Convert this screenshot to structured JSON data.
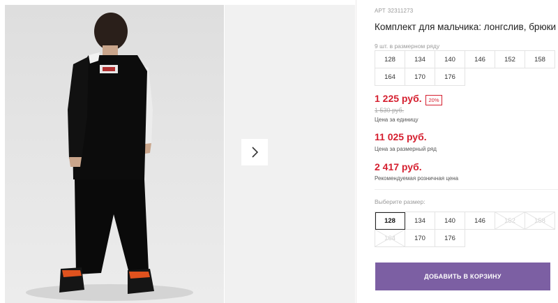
{
  "gallery": {
    "next_icon": "chevron-right-icon",
    "photo_subject": "boy-in-black-longsleeve-and-pants-back-view"
  },
  "product": {
    "sku_label": "АРТ",
    "sku": "32311273",
    "title": "Комплект для мальчика: лонгслив, брюки"
  },
  "size_run": {
    "label": "9 шт. в размерном ряду",
    "sizes": [
      "128",
      "134",
      "140",
      "146",
      "152",
      "158",
      "164",
      "170",
      "176"
    ]
  },
  "pricing": {
    "price": "1 225 руб.",
    "discount": "20%",
    "old_price": "1 530 руб.",
    "price_label": "Цена за единицу",
    "run_price": "11 025 руб.",
    "run_price_label": "Цена за размерный ряд",
    "rrp": "2 417 руб.",
    "rrp_label": "Рекомендуемая розничная цена",
    "accent_color": "#d51f2f"
  },
  "size_select": {
    "label": "Выберите размер:",
    "options": [
      {
        "size": "128",
        "selected": true,
        "available": true
      },
      {
        "size": "134",
        "selected": false,
        "available": true
      },
      {
        "size": "140",
        "selected": false,
        "available": true
      },
      {
        "size": "146",
        "selected": false,
        "available": true
      },
      {
        "size": "152",
        "selected": false,
        "available": false
      },
      {
        "size": "158",
        "selected": false,
        "available": false
      },
      {
        "size": "164",
        "selected": false,
        "available": false
      },
      {
        "size": "170",
        "selected": false,
        "available": true
      },
      {
        "size": "176",
        "selected": false,
        "available": true
      }
    ]
  },
  "cart": {
    "button_label": "ДОБАВИТЬ В КОРЗИНУ",
    "button_color": "#7c5fa3"
  }
}
